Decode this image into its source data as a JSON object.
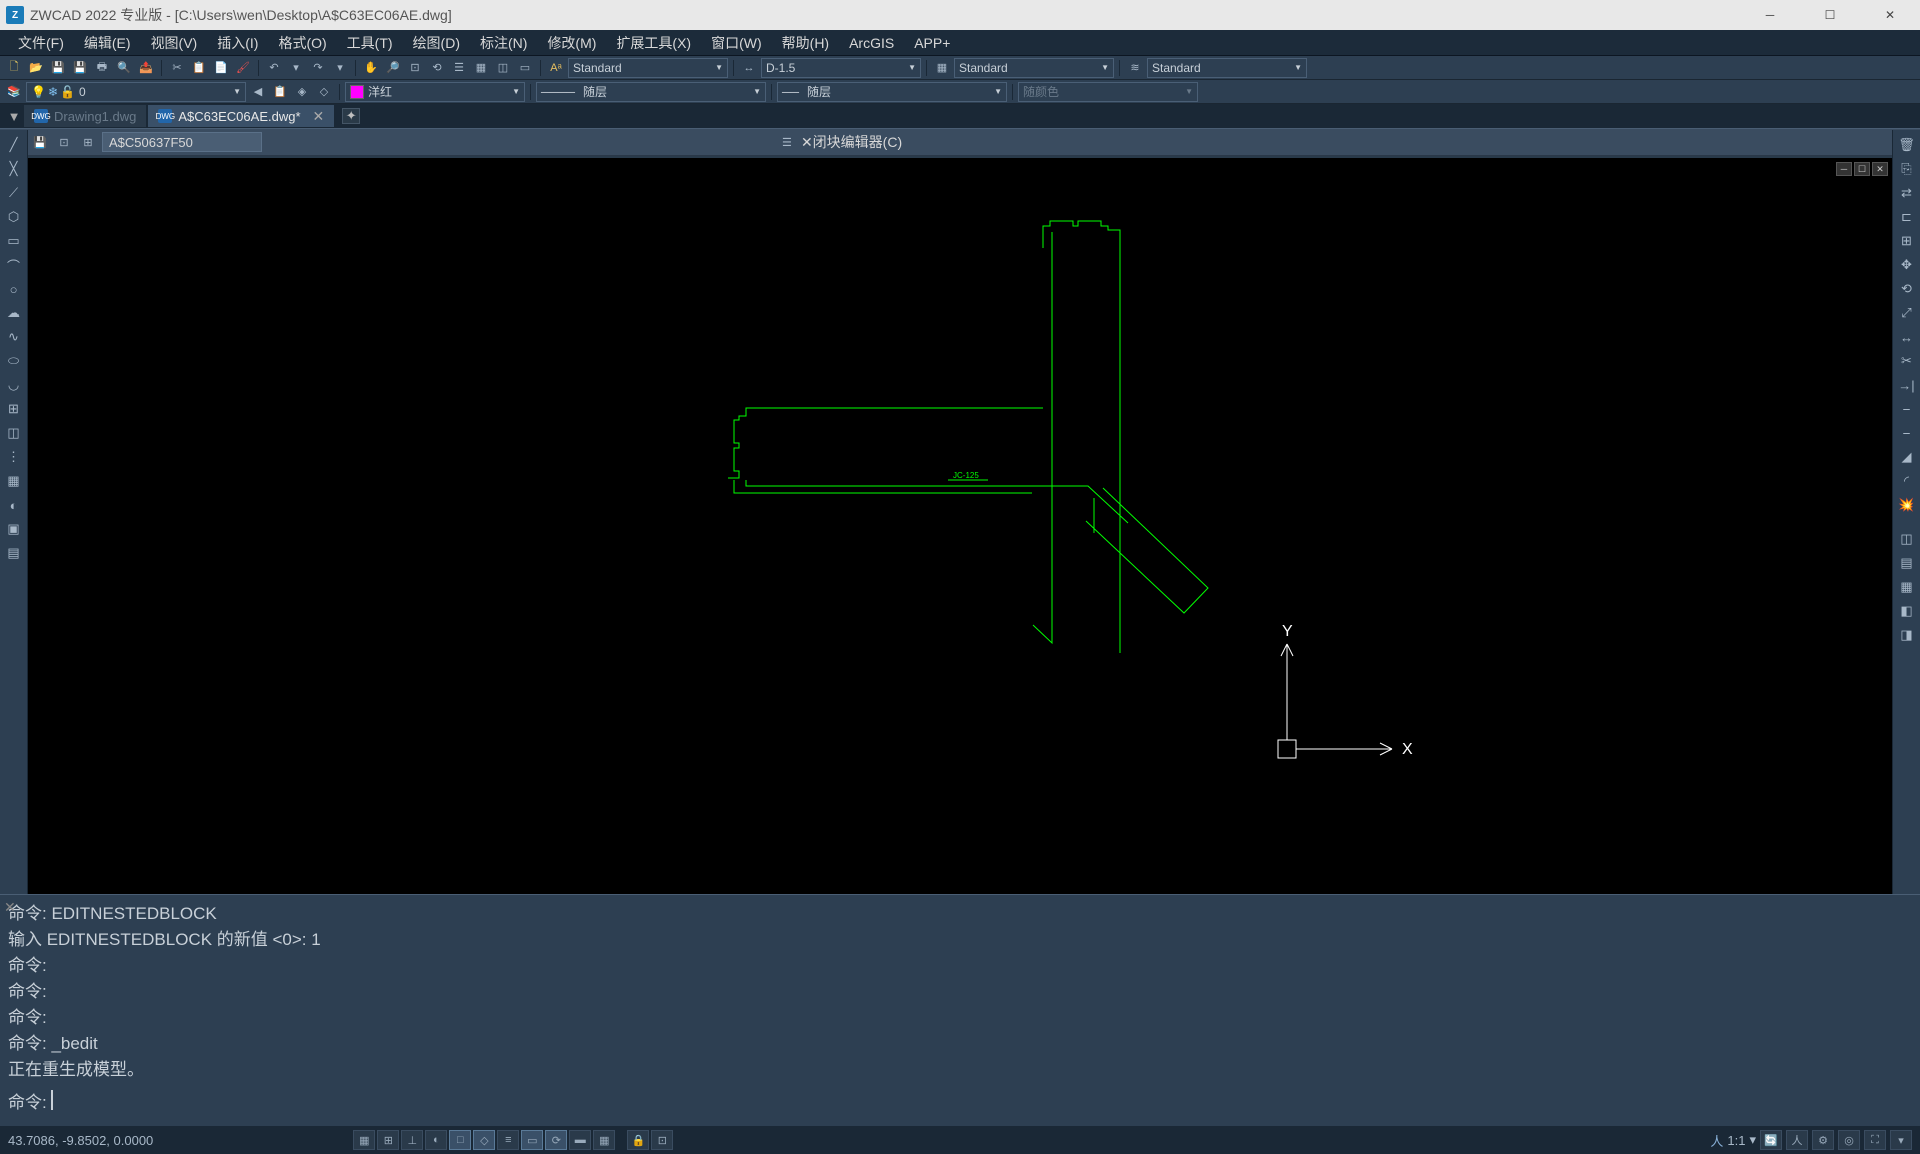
{
  "titlebar": {
    "app": "ZWCAD 2022 专业版",
    "file": "[C:\\Users\\wen\\Desktop\\A$C63EC06AE.dwg]"
  },
  "menu": {
    "file": "文件(F)",
    "edit": "编辑(E)",
    "view": "视图(V)",
    "insert": "插入(I)",
    "format": "格式(O)",
    "tools": "工具(T)",
    "draw": "绘图(D)",
    "dimension": "标注(N)",
    "modify": "修改(M)",
    "extension": "扩展工具(X)",
    "window": "窗口(W)",
    "help": "帮助(H)",
    "arcgis": "ArcGIS",
    "appplus": "APP+"
  },
  "toolbar1": {
    "standard1": "Standard",
    "dimstyle": "D-1.5",
    "standard2": "Standard",
    "standard3": "Standard"
  },
  "toolbar2": {
    "layer_num": "0",
    "color_name": "洋红",
    "linetype": "随层",
    "lineweight": "随层",
    "plotstyle": "随颜色"
  },
  "tabs": {
    "inactive": "Drawing1.dwg",
    "active": "A$C63EC06AE.dwg*"
  },
  "blockbar": {
    "blockname": "A$C50637F50",
    "editor_label": "闭块编辑器(C)"
  },
  "drawing": {
    "label": "JC-125"
  },
  "ucs": {
    "x": "X",
    "y": "Y"
  },
  "commands": {
    "l1": "命令: EDITNESTEDBLOCK",
    "l2": "输入 EDITNESTEDBLOCK 的新值 <0>: 1",
    "l3": "命令:",
    "l4": "命令:",
    "l5": "命令:",
    "l6": "命令: _bedit",
    "l7": "正在重生成模型。",
    "prompt": "命令:"
  },
  "status": {
    "coords": "43.7086, -9.8502, 0.0000",
    "scale": "1:1"
  }
}
